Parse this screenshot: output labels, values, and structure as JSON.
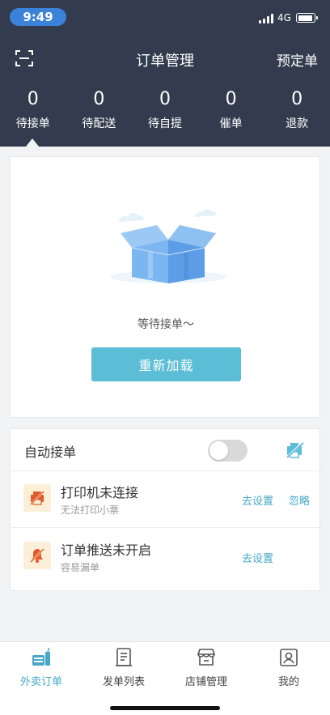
{
  "status_bar": {
    "time": "9:49",
    "network": "4G",
    "signal_bars": 4,
    "battery_level": 0.85
  },
  "navbar": {
    "title": "订单管理",
    "right_action": "预定单",
    "left_icon": "scan-icon"
  },
  "order_tabs": [
    {
      "count": "0",
      "label": "待接单",
      "active": true
    },
    {
      "count": "0",
      "label": "待配送"
    },
    {
      "count": "0",
      "label": "待自提"
    },
    {
      "count": "0",
      "label": "催单"
    },
    {
      "count": "0",
      "label": "退款"
    }
  ],
  "empty_state": {
    "message": "等待接单～",
    "reload_button": "重新加载",
    "illustration": "empty-box-icon"
  },
  "auto_accept": {
    "label": "自动接单",
    "enabled": false,
    "icon": "printer-off-icon"
  },
  "alerts": [
    {
      "title": "打印机未连接",
      "subtitle": "无法打印小票",
      "action": "去设置",
      "secondary_action": "忽略",
      "icon": "printer-off-icon"
    },
    {
      "title": "订单推送未开启",
      "subtitle": "容易漏单",
      "action": "去设置",
      "icon": "bell-off-icon"
    }
  ],
  "bottom_tabs": [
    {
      "label": "外卖订单",
      "active": true,
      "icon": "takeout-icon"
    },
    {
      "label": "发单列表",
      "icon": "list-doc-icon"
    },
    {
      "label": "店铺管理",
      "icon": "store-icon"
    },
    {
      "label": "我的",
      "icon": "profile-icon"
    }
  ],
  "colors": {
    "header_bg": "#323c4e",
    "accent": "#47a8c8",
    "button_bg": "#5bbdd6",
    "time_pill": "#3b82d9",
    "alert_icon_bg": "#fbefd8",
    "alert_icon_fg": "#e05a2b"
  }
}
